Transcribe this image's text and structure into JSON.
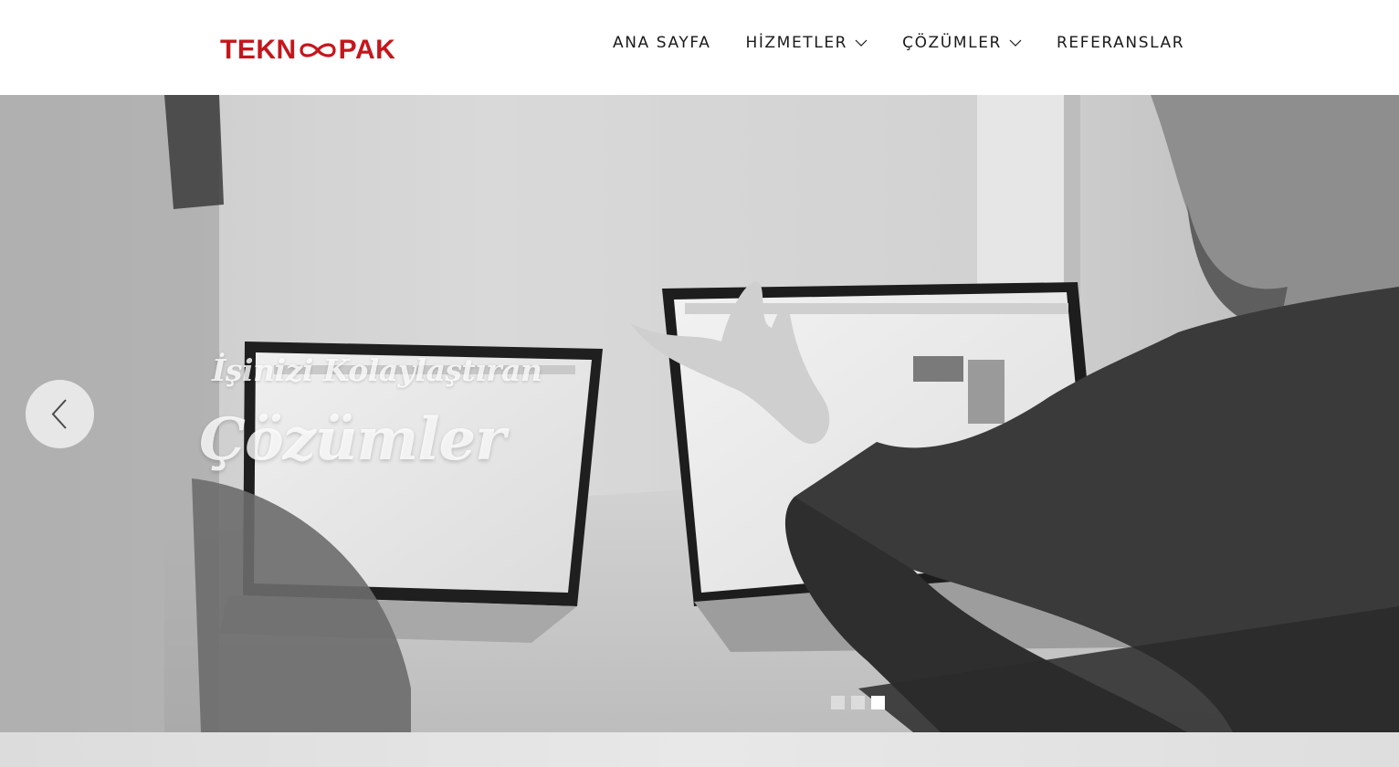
{
  "header": {
    "logo": {
      "left_text": "TEKN",
      "right_text": "PAK",
      "brand_color": "#c4161c"
    },
    "nav": [
      {
        "label": "ANA SAYFA",
        "has_dropdown": false
      },
      {
        "label": "HİZMETLER",
        "has_dropdown": true
      },
      {
        "label": "ÇÖZÜMLER",
        "has_dropdown": true
      },
      {
        "label": "REFERANSLAR",
        "has_dropdown": false
      }
    ]
  },
  "hero": {
    "kicker": "İşinizi Kolaylaştıran",
    "title": "Çözümler",
    "prev_icon": "chevron-left-icon",
    "slides_total": 3,
    "active_slide": 3
  },
  "colors": {
    "text": "#1a1a1a",
    "brand": "#c4161c"
  }
}
